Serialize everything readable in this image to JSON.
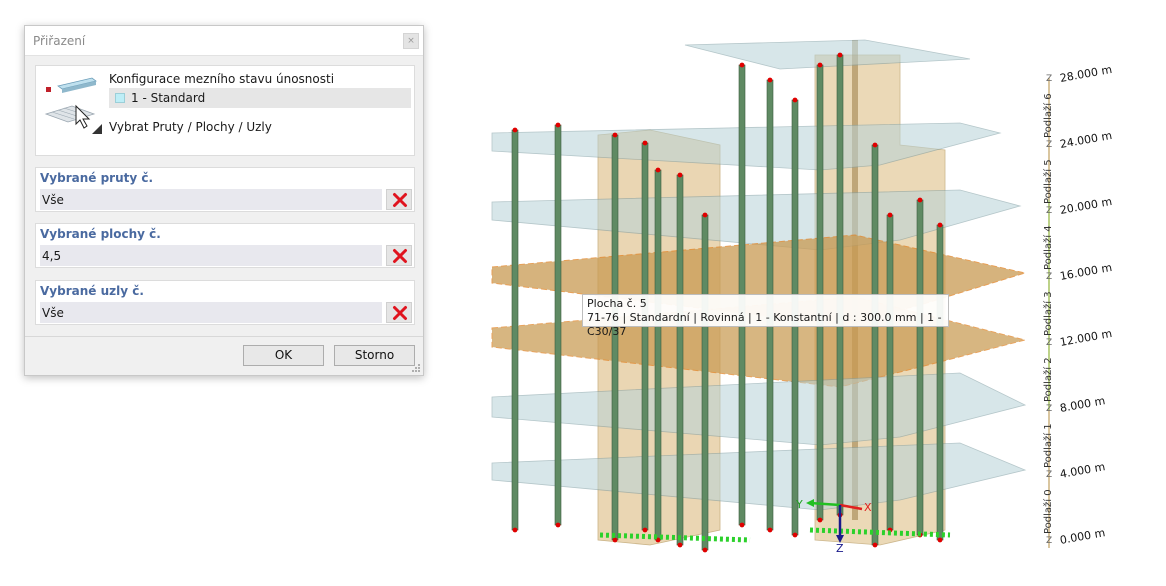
{
  "dialog": {
    "title": "Přiřazení",
    "close_glyph": "×",
    "config_label": "Konfigurace mezního stavu únosnosti",
    "config_value": "1 - Standard",
    "select_link": "Vybrat Pruty / Plochy / Uzly",
    "fields": [
      {
        "label": "Vybrané pruty č.",
        "value": "Vše"
      },
      {
        "label": "Vybrané plochy č.",
        "value": "4,5"
      },
      {
        "label": "Vybrané uzly č.",
        "value": "Vše"
      }
    ],
    "ok_label": "OK",
    "cancel_label": "Storno"
  },
  "tooltip": {
    "line1": "Plocha č. 5",
    "line2": "71-76 | Standardní | Rovinná | 1 - Konstantní | d : 300.0 mm | 1 - C30/37"
  },
  "axes": {
    "y": "Y",
    "x": "X",
    "z": "Z"
  },
  "levels": [
    {
      "elevation": "28.000 m",
      "storey": "Podlaží 6"
    },
    {
      "elevation": "24.000 m",
      "storey": "Podlaží 5"
    },
    {
      "elevation": "20.000 m",
      "storey": "Podlaží 4"
    },
    {
      "elevation": "16.000 m",
      "storey": "Podlaží 3"
    },
    {
      "elevation": "12.000 m",
      "storey": "Podlaží 2"
    },
    {
      "elevation": "8.000 m",
      "storey": "Podlaží 1"
    },
    {
      "elevation": "4.000 m",
      "storey": "Podlaží 0"
    },
    {
      "elevation": "0.000 m",
      "storey": ""
    }
  ],
  "level_marker": "Z",
  "colors": {
    "column": "#5f8a63",
    "slab": "#b8d3d8",
    "slab_selected": "#c99a52",
    "wall": "#e3c99a",
    "node": "#e00000",
    "support": "#2bd12b",
    "label_accent": "#4a6aa0"
  }
}
